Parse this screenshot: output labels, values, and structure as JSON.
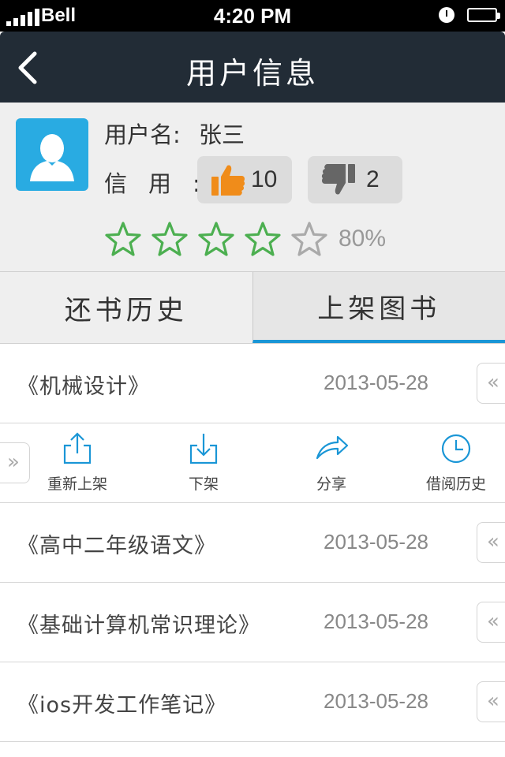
{
  "status_bar": {
    "carrier": "Bell",
    "time": "4:20 PM"
  },
  "navbar": {
    "title": "用户信息",
    "back_icon": "chevron-left-icon"
  },
  "profile": {
    "username_label": "用户名:",
    "username": "张三",
    "credit_label": "信用:",
    "likes": "10",
    "dislikes": "2",
    "rating_stars": 4,
    "rating_max": 5,
    "rating_percent": "80%",
    "colors": {
      "star_filled": "#4caf50",
      "star_empty": "#aaaaaa",
      "thumb_up": "#f08c1a",
      "thumb_down": "#666666",
      "avatar_bg": "#29abe2"
    }
  },
  "tabs": [
    {
      "label": "还书历史",
      "active": false
    },
    {
      "label": "上架图书",
      "active": true
    }
  ],
  "accent_color": "#1a96d6",
  "books": [
    {
      "title": "《机械设计》",
      "date": "2013-05-28"
    },
    {
      "title": "《高中二年级语文》",
      "date": "2013-05-28"
    },
    {
      "title": "《基础计算机常识理论》",
      "date": "2013-05-28"
    },
    {
      "title": "《ios开发工作笔记》",
      "date": "2013-05-28"
    }
  ],
  "row_actions": [
    {
      "label": "重新上架",
      "icon": "share-upload-icon"
    },
    {
      "label": "下架",
      "icon": "download-tray-icon"
    },
    {
      "label": "分享",
      "icon": "forward-arrow-icon"
    },
    {
      "label": "借阅历史",
      "icon": "clock-icon"
    }
  ],
  "swipe_open_glyph": "«",
  "swipe_close_glyph": "»"
}
